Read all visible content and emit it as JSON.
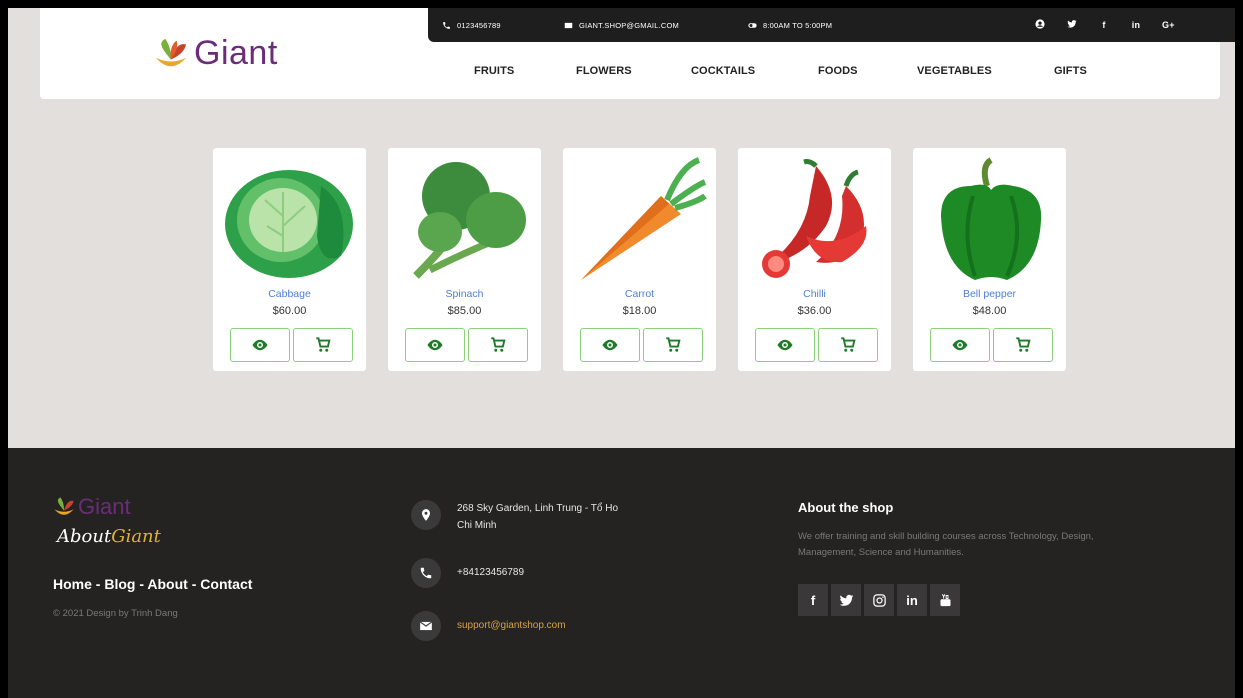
{
  "topbar": {
    "phone": "0123456789",
    "email": "GIANT.SHOP@GMAIL.COM",
    "hours": "8:00AM TO 5:00PM",
    "social_icons": [
      "user-circle-icon",
      "twitter-icon",
      "facebook-icon",
      "linkedin-icon",
      "google-plus-icon"
    ],
    "social_labels": {
      "facebook": "f",
      "linkedin": "in",
      "google": "G+"
    }
  },
  "brand": {
    "name": "Giant",
    "color": "#6b2d7a"
  },
  "nav": [
    "FRUITS",
    "FLOWERS",
    "COCKTAILS",
    "FOODS",
    "VEGETABLES",
    "GIFTS"
  ],
  "products": [
    {
      "name": "Cabbage",
      "price": "$60.00"
    },
    {
      "name": "Spinach",
      "price": "$85.00"
    },
    {
      "name": "Carrot",
      "price": "$18.00"
    },
    {
      "name": "Chilli",
      "price": "$36.00"
    },
    {
      "name": "Bell pepper",
      "price": "$48.00"
    }
  ],
  "footer": {
    "brand": "Giant",
    "about_a": "About",
    "about_g": "Giant",
    "links": {
      "home": "Home",
      "blog": "Blog",
      "about": "About",
      "contact": "Contact",
      "sep": " - "
    },
    "copyright": "© 2021 Design by Trinh Dang",
    "address": "268 Sky Garden, Linh Trung - Tổ Ho Chi Minh",
    "phone": "+84123456789",
    "email": "support@giantshop.com",
    "shop_title": "About the shop",
    "shop_desc": "We offer training and skill building courses across Technology, Design, Management, Science and Humanities.",
    "social_labels": {
      "facebook": "f",
      "linkedin": "in"
    }
  },
  "colors": {
    "accent_green": "#1f7a2a",
    "button_border": "#8bd17a",
    "link_blue": "#4d7fd1",
    "footer_bg": "#252322",
    "email_gold": "#d4a341"
  }
}
